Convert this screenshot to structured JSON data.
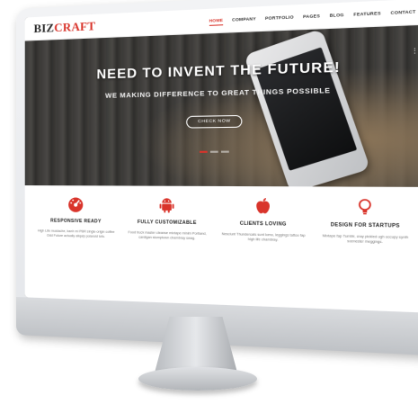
{
  "header": {
    "logo_main": "BIZ",
    "logo_accent": "CRAFT",
    "nav": [
      {
        "label": "HOME",
        "active": true
      },
      {
        "label": "COMPANY",
        "active": false
      },
      {
        "label": "PORTFOLIO",
        "active": false
      },
      {
        "label": "PAGES",
        "active": false
      },
      {
        "label": "BLOG",
        "active": false
      },
      {
        "label": "FEATURES",
        "active": false
      },
      {
        "label": "CONTACT",
        "active": false
      }
    ]
  },
  "hero": {
    "title": "NEED TO INVENT THE FUTURE!",
    "subtitle": "WE MAKING DIFFERENCE TO GREAT THINGS POSSIBLE",
    "button_label": "CHECK NOW",
    "share_icon": "share-icon",
    "slides": 3,
    "active_slide": 1
  },
  "features": [
    {
      "icon": "speedometer-icon",
      "title": "RESPONSIVE READY",
      "text": "High Life mustache, banh mi PBR single-origin coffee Odd Future actually aliquip polaroid tofu."
    },
    {
      "icon": "android-icon",
      "title": "FULLY CUSTOMIZABLE",
      "text": "Food truck master cleanse mixtape minim Portland, cardigan stumptown chambray swag."
    },
    {
      "icon": "apple-icon",
      "title": "CLIENTS LOVING",
      "text": "Nesciunt Thundercats sunt lomo, leggings tattoo fap high life chambray."
    },
    {
      "icon": "lightbulb-icon",
      "title": "DESIGN FOR STARTUPS",
      "text": "Mixtape fap Tumblr, cray pickled ugh occupy synth scenester meggings."
    }
  ],
  "colors": {
    "accent": "#d9342b",
    "dark": "#222222"
  }
}
